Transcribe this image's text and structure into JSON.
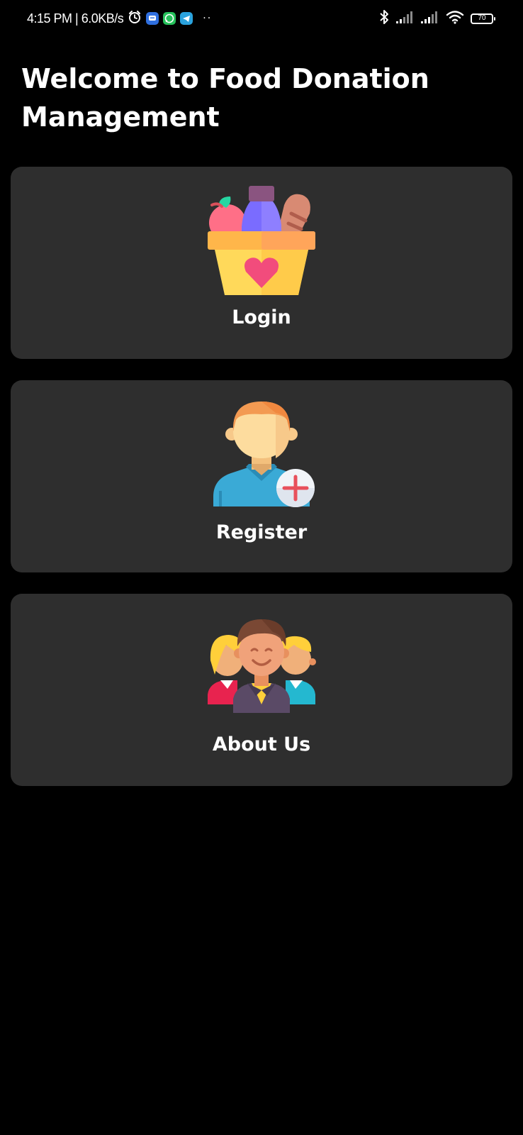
{
  "status_bar": {
    "time_text": "4:15 PM | 6.0KB/s",
    "icons": [
      "alarm-icon",
      "messages-app-icon",
      "whatsapp-icon",
      "telegram-icon",
      "more-notifications-icon",
      "bluetooth-icon",
      "signal-icon",
      "signal-icon",
      "wifi-icon",
      "battery-icon"
    ],
    "more_dots": "··",
    "battery_level": "70"
  },
  "header": {
    "title": "Welcome to Food Donation Management"
  },
  "menu": {
    "items": [
      {
        "label": "Login",
        "icon": "food-basket-icon"
      },
      {
        "label": "Register",
        "icon": "add-user-icon"
      },
      {
        "label": "About Us",
        "icon": "team-icon"
      }
    ]
  },
  "colors": {
    "background": "#000000",
    "card": "#2e2e2e",
    "text": "#ffffff"
  }
}
